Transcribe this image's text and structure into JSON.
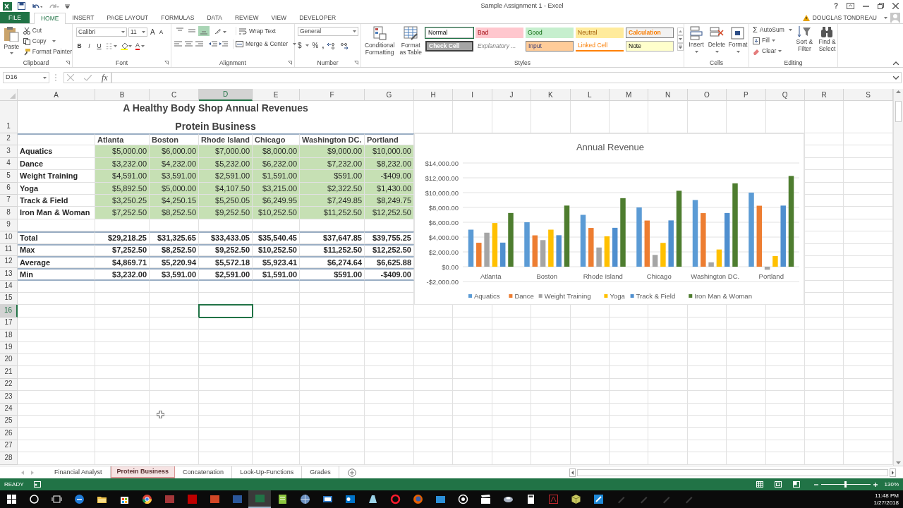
{
  "title_bar": {
    "title": "Sample Assignment 1 - Excel",
    "help": "?"
  },
  "ribbon_tabs": [
    {
      "label": "FILE",
      "kind": "file",
      "selected": false
    },
    {
      "label": "HOME",
      "kind": "tab",
      "selected": true
    },
    {
      "label": "INSERT",
      "kind": "tab",
      "selected": false
    },
    {
      "label": "PAGE LAYOUT",
      "kind": "tab",
      "selected": false
    },
    {
      "label": "FORMULAS",
      "kind": "tab",
      "selected": false
    },
    {
      "label": "DATA",
      "kind": "tab",
      "selected": false
    },
    {
      "label": "REVIEW",
      "kind": "tab",
      "selected": false
    },
    {
      "label": "VIEW",
      "kind": "tab",
      "selected": false
    },
    {
      "label": "DEVELOPER",
      "kind": "tab",
      "selected": false
    }
  ],
  "user": {
    "name": "DOUGLAS TONDREAU"
  },
  "ribbon": {
    "clipboard": {
      "paste": "Paste",
      "cut": "Cut",
      "copy": "Copy",
      "format_painter": "Format Painter",
      "label": "Clipboard"
    },
    "font": {
      "font_name": "Calibri",
      "font_size": "11",
      "grow": "A",
      "shrink": "A",
      "bold": "B",
      "italic": "I",
      "underline": "U",
      "font_color": "A",
      "label": "Font"
    },
    "alignment": {
      "vertical": [
        {
          "kind": "top",
          "selected": false
        },
        {
          "kind": "middle",
          "selected": false
        },
        {
          "kind": "bottom",
          "selected": true
        }
      ],
      "wrap_text": "Wrap Text",
      "merge_center": "Merge & Center",
      "label": "Alignment"
    },
    "number": {
      "format": "General",
      "currency": "$",
      "percent": "%",
      "comma": ",",
      "label": "Number"
    },
    "styles": {
      "conditional_formatting": "Conditional Formatting",
      "format_as_table": "Format as Table",
      "label": "Styles",
      "gallery": [
        {
          "label": "Normal",
          "kind": "normal",
          "selected": true
        },
        {
          "label": "Bad",
          "kind": "bad",
          "selected": false
        },
        {
          "label": "Good",
          "kind": "good",
          "selected": false
        },
        {
          "label": "Neutral",
          "kind": "neutral",
          "selected": false
        },
        {
          "label": "Calculation",
          "kind": "calculation",
          "selected": false
        },
        {
          "label": "Check Cell",
          "kind": "check",
          "selected": false
        },
        {
          "label": "Explanatory ...",
          "kind": "explanatory",
          "selected": false
        },
        {
          "label": "Input",
          "kind": "input",
          "selected": false
        },
        {
          "label": "Linked Cell",
          "kind": "linked",
          "selected": false
        },
        {
          "label": "Note",
          "kind": "note",
          "selected": false
        }
      ]
    },
    "cells": {
      "insert": "Insert",
      "delete": "Delete",
      "format": "Format",
      "label": "Cells"
    },
    "editing": {
      "sigma": "Σ",
      "autosum": "AutoSum",
      "fill": "Fill",
      "clear": "Clear",
      "sort_filter": "Sort & Filter",
      "find_select": "Find & Select",
      "label": "Editing"
    }
  },
  "formula_bar": {
    "name_box": "D16",
    "fx": "fx"
  },
  "sheet": {
    "columns": [
      {
        "label": "A",
        "selected": false
      },
      {
        "label": "B",
        "selected": false
      },
      {
        "label": "C",
        "selected": false
      },
      {
        "label": "D",
        "selected": true
      },
      {
        "label": "E",
        "selected": false
      },
      {
        "label": "F",
        "selected": false
      },
      {
        "label": "G",
        "selected": false
      },
      {
        "label": "H",
        "selected": false
      },
      {
        "label": "I",
        "selected": false
      },
      {
        "label": "J",
        "selected": false
      },
      {
        "label": "K",
        "selected": false
      },
      {
        "label": "L",
        "selected": false
      },
      {
        "label": "M",
        "selected": false
      },
      {
        "label": "N",
        "selected": false
      },
      {
        "label": "O",
        "selected": false
      },
      {
        "label": "P",
        "selected": false
      },
      {
        "label": "Q",
        "selected": false
      },
      {
        "label": "R",
        "selected": false
      },
      {
        "label": "S",
        "selected": false
      }
    ],
    "rows": [
      {
        "label": "1",
        "selected": false
      },
      {
        "label": "2",
        "selected": false
      },
      {
        "label": "3",
        "selected": false
      },
      {
        "label": "4",
        "selected": false
      },
      {
        "label": "5",
        "selected": false
      },
      {
        "label": "6",
        "selected": false
      },
      {
        "label": "7",
        "selected": false
      },
      {
        "label": "8",
        "selected": false
      },
      {
        "label": "9",
        "selected": false
      },
      {
        "label": "10",
        "selected": false
      },
      {
        "label": "11",
        "selected": false
      },
      {
        "label": "12",
        "selected": false
      },
      {
        "label": "13",
        "selected": false
      },
      {
        "label": "14",
        "selected": false
      },
      {
        "label": "15",
        "selected": false
      },
      {
        "label": "16",
        "selected": true
      },
      {
        "label": "17",
        "selected": false
      },
      {
        "label": "18",
        "selected": false
      },
      {
        "label": "19",
        "selected": false
      },
      {
        "label": "20",
        "selected": false
      },
      {
        "label": "21",
        "selected": false
      },
      {
        "label": "22",
        "selected": false
      },
      {
        "label": "23",
        "selected": false
      },
      {
        "label": "24",
        "selected": false
      },
      {
        "label": "25",
        "selected": false
      },
      {
        "label": "26",
        "selected": false
      },
      {
        "label": "27",
        "selected": false
      },
      {
        "label": "28",
        "selected": false
      }
    ],
    "title": "A Healthy Body Shop Annual Revenues",
    "subtitle": "Protein Business",
    "headers": [
      "Atlanta",
      "Boston",
      "Rhode Island",
      "Chicago",
      "Washington DC.",
      "Portland"
    ],
    "data_rows": [
      {
        "label": "Aquatics",
        "values": [
          "$5,000.00",
          "$6,000.00",
          "$7,000.00",
          "$8,000.00",
          "$9,000.00",
          "$10,000.00"
        ]
      },
      {
        "label": "Dance",
        "values": [
          "$3,232.00",
          "$4,232.00",
          "$5,232.00",
          "$6,232.00",
          "$7,232.00",
          "$8,232.00"
        ]
      },
      {
        "label": "Weight Training",
        "values": [
          "$4,591.00",
          "$3,591.00",
          "$2,591.00",
          "$1,591.00",
          "$591.00",
          "-$409.00"
        ]
      },
      {
        "label": "Yoga",
        "values": [
          "$5,892.50",
          "$5,000.00",
          "$4,107.50",
          "$3,215.00",
          "$2,322.50",
          "$1,430.00"
        ]
      },
      {
        "label": "Track & Field",
        "values": [
          "$3,250.25",
          "$4,250.15",
          "$5,250.05",
          "$6,249.95",
          "$7,249.85",
          "$8,249.75"
        ]
      },
      {
        "label": "Iron Man & Woman",
        "values": [
          "$7,252.50",
          "$8,252.50",
          "$9,252.50",
          "$10,252.50",
          "$11,252.50",
          "$12,252.50"
        ]
      }
    ],
    "summary_rows": [
      {
        "label": "Total",
        "values": [
          "$29,218.25",
          "$31,325.65",
          "$33,433.05",
          "$35,540.45",
          "$37,647.85",
          "$39,755.25"
        ]
      },
      {
        "label": "Max",
        "values": [
          "$7,252.50",
          "$8,252.50",
          "$9,252.50",
          "$10,252.50",
          "$11,252.50",
          "$12,252.50"
        ]
      },
      {
        "label": "Average",
        "values": [
          "$4,869.71",
          "$5,220.94",
          "$5,572.18",
          "$5,923.41",
          "$6,274.64",
          "$6,625.88"
        ]
      },
      {
        "label": "Min",
        "values": [
          "$3,232.00",
          "$3,591.00",
          "$2,591.00",
          "$1,591.00",
          "$591.00",
          "-$409.00"
        ]
      }
    ]
  },
  "chart": {
    "chart_data": {
      "type": "bar",
      "title": "Annual Revenue",
      "grid": true,
      "legend": "bottom",
      "categories": [
        "Atlanta",
        "Boston",
        "Rhode Island",
        "Chicago",
        "Washington DC.",
        "Portland"
      ],
      "series": [
        {
          "name": "Aquatics",
          "color": "#5b9bd5",
          "values": [
            5000,
            6000,
            7000,
            8000,
            9000,
            10000
          ]
        },
        {
          "name": "Dance",
          "color": "#ed7d31",
          "values": [
            3232,
            4232,
            5232,
            6232,
            7232,
            8232
          ]
        },
        {
          "name": "Weight Training",
          "color": "#a5a5a5",
          "values": [
            4591,
            3591,
            2591,
            1591,
            591,
            -409
          ]
        },
        {
          "name": "Yoga",
          "color": "#ffc000",
          "values": [
            5892.5,
            5000,
            4107.5,
            3215,
            2322.5,
            1430
          ]
        },
        {
          "name": "Track & Field",
          "color": "#4f8fcf",
          "values": [
            3250.25,
            4250.15,
            5250.05,
            6249.95,
            7249.85,
            8249.75
          ]
        },
        {
          "name": "Iron Man & Woman",
          "color": "#4e7d2f",
          "values": [
            7252.5,
            8252.5,
            9252.5,
            10252.5,
            11252.5,
            12252.5
          ]
        }
      ],
      "ylim": [
        -2000,
        14000
      ],
      "yticks": [
        {
          "value": -2000,
          "label": "-$2,000.00"
        },
        {
          "value": 0,
          "label": "$0.00"
        },
        {
          "value": 2000,
          "label": "$2,000.00"
        },
        {
          "value": 4000,
          "label": "$4,000.00"
        },
        {
          "value": 6000,
          "label": "$6,000.00"
        },
        {
          "value": 8000,
          "label": "$8,000.00"
        },
        {
          "value": 10000,
          "label": "$10,000.00"
        },
        {
          "value": 12000,
          "label": "$12,000.00"
        },
        {
          "value": 14000,
          "label": "$14,000.00"
        }
      ]
    }
  },
  "sheet_tabs": [
    {
      "label": "Financial Analyst",
      "selected": false
    },
    {
      "label": "Protein Business",
      "selected": true
    },
    {
      "label": "Concatenation",
      "selected": false
    },
    {
      "label": "Look-Up-Functions",
      "selected": false
    },
    {
      "label": "Grades",
      "selected": false
    }
  ],
  "status_bar": {
    "mode": "READY",
    "zoom": {
      "level": 0.5,
      "reading": "130%"
    }
  },
  "taskbar": {
    "apps": [
      {
        "kind": "windows",
        "active": false
      },
      {
        "kind": "search",
        "active": false
      },
      {
        "kind": "taskview",
        "active": false
      },
      {
        "kind": "edge",
        "active": false
      },
      {
        "kind": "folder",
        "active": false
      },
      {
        "kind": "store",
        "active": false
      },
      {
        "kind": "chrome",
        "active": false
      },
      {
        "kind": "access",
        "active": false
      },
      {
        "kind": "filezilla",
        "active": false
      },
      {
        "kind": "powerpoint",
        "active": false
      },
      {
        "kind": "word",
        "active": false
      },
      {
        "kind": "excel",
        "active": true
      },
      {
        "kind": "notepad",
        "active": false
      },
      {
        "kind": "globe",
        "active": false
      },
      {
        "kind": "window",
        "active": false
      },
      {
        "kind": "outlook",
        "active": false
      },
      {
        "kind": "drive",
        "active": false
      },
      {
        "kind": "opera",
        "active": false
      },
      {
        "kind": "firefox",
        "active": false
      },
      {
        "kind": "blueapp",
        "active": false
      },
      {
        "kind": "target",
        "active": false
      },
      {
        "kind": "clapper",
        "active": false
      },
      {
        "kind": "disk",
        "active": false
      },
      {
        "kind": "calculator",
        "active": false
      },
      {
        "kind": "pdf",
        "active": false
      },
      {
        "kind": "cube",
        "active": false
      },
      {
        "kind": "arrowapp",
        "active": false
      },
      {
        "kind": "dim",
        "active": false
      },
      {
        "kind": "dim",
        "active": false
      },
      {
        "kind": "dim",
        "active": false
      },
      {
        "kind": "dim",
        "active": false
      }
    ],
    "time": "11:48 PM",
    "date": "1/27/2018"
  }
}
